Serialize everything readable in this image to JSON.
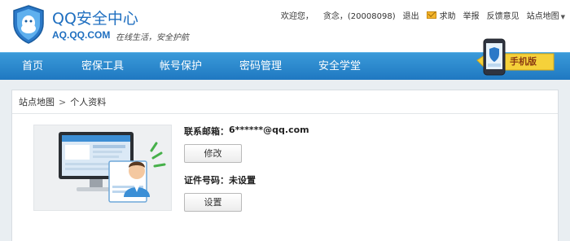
{
  "brand": {
    "title": "QQ安全中心",
    "url": "AQ.QQ.COM",
    "slogan": "在线生活，安全护航"
  },
  "toplinks": {
    "welcome": "欢迎您，",
    "user": "贪念，(20008098)",
    "logout": "退出",
    "help": "求助",
    "report": "举报",
    "feedback": "反馈意见",
    "sitemap": "站点地图",
    "sitemap_arrow": "▼"
  },
  "nav": {
    "items": [
      "首页",
      "密保工具",
      "帐号保护",
      "密码管理",
      "安全学堂"
    ]
  },
  "badge": {
    "label": "手机版"
  },
  "breadcrumb": {
    "root": "站点地图",
    "separator": ">",
    "current": "个人资料"
  },
  "profile": {
    "email_label": "联系邮箱：",
    "email_value": "6******@qq.com",
    "modify_button": "修改",
    "id_label": "证件号码：",
    "id_value": "未设置",
    "set_button": "设置"
  },
  "colors": {
    "brand_blue": "#1f6fc0",
    "nav_blue": "#2a87cc",
    "badge_yellow": "#f7d23a"
  }
}
